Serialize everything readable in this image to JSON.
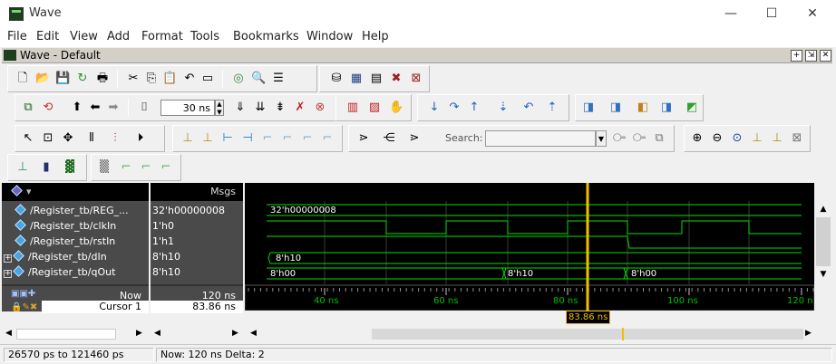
{
  "app": {
    "title": "Wave"
  },
  "window_controls": {
    "minimize": "—",
    "maximize": "☐",
    "close": "✕"
  },
  "menu": [
    "File",
    "Edit",
    "View",
    "Add",
    "Format",
    "Tools",
    "Bookmarks",
    "Window",
    "Help"
  ],
  "wave_window": {
    "title": "Wave - Default"
  },
  "toolbar": {
    "run_length_value": "30 ns",
    "search_label": "Search:",
    "search_placeholder": ""
  },
  "columns": {
    "msgs": "Msgs"
  },
  "signals": [
    {
      "name": "/Register_tb/REG_...",
      "value": "32'h00000008",
      "expandable": false
    },
    {
      "name": "/Register_tb/clkIn",
      "value": "1'h0",
      "expandable": false
    },
    {
      "name": "/Register_tb/rstIn",
      "value": "1'h1",
      "expandable": false
    },
    {
      "name": "/Register_tb/dIn",
      "value": "8'h10",
      "expandable": true
    },
    {
      "name": "/Register_tb/qOut",
      "value": "8'h10",
      "expandable": true
    }
  ],
  "wave_labels": {
    "reg": "32'h00000008",
    "din": "8'h10",
    "qout_a": "8'h00",
    "qout_b": "8'h10",
    "qout_c": "8'h00"
  },
  "timeline": {
    "now_label": "Now",
    "now_value": "120 ns",
    "cursor_label": "Cursor 1",
    "cursor_value": "83.86 ns",
    "cursor_tag": "83.86 ns",
    "ticks": [
      "40 ns",
      "60 ns",
      "80 ns",
      "100 ns",
      "120 n"
    ]
  },
  "status": {
    "range": "26570 ps to 121460 ps",
    "now": "Now: 120 ns  Delta: 2"
  },
  "colors": {
    "wave": "#00e000",
    "cursor": "#f0c000",
    "pane_bg": "#4a4a4a"
  }
}
